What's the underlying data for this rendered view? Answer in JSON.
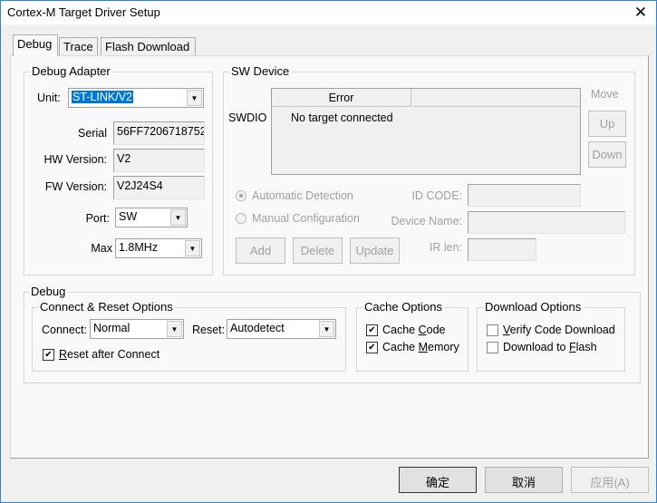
{
  "window": {
    "title": "Cortex-M Target Driver Setup"
  },
  "tabs": [
    {
      "label": "Debug",
      "selected": true
    },
    {
      "label": "Trace"
    },
    {
      "label": "Flash Download"
    }
  ],
  "debug_adapter": {
    "legend": "Debug Adapter",
    "unit_label": "Unit:",
    "unit_value": "ST-LINK/V2",
    "serial_label": "Serial",
    "serial_value": "56FF7206718752",
    "hw_label": "HW Version:",
    "hw_value": "V2",
    "fw_label": "FW Version:",
    "fw_value": "V2J24S4",
    "port_label": "Port:",
    "port_value": "SW",
    "max_label": "Max",
    "max_value": "1.8MHz"
  },
  "sw_device": {
    "legend": "SW Device",
    "row_label": "SWDIO",
    "columns": [
      "Error",
      ""
    ],
    "rows": [
      [
        "No target connected",
        ""
      ]
    ],
    "move_label": "Move",
    "up": "Up",
    "down": "Down",
    "auto_detect": "Automatic Detection",
    "manual_config": "Manual Configuration",
    "selected_mode": "Automatic Detection",
    "id_code_label": "ID CODE:",
    "id_code_value": "",
    "device_name_label": "Device Name:",
    "device_name_value": "",
    "ir_len_label": "IR len:",
    "ir_len_value": "",
    "add": "Add",
    "delete": "Delete",
    "update": "Update"
  },
  "debug": {
    "legend": "Debug",
    "connect_reset": {
      "legend": "Connect & Reset Options",
      "connect_label": "Connect:",
      "connect_value": "Normal",
      "reset_label": "Reset:",
      "reset_value": "Autodetect",
      "reset_after_connect_u": "R",
      "reset_after_connect_rest": "eset after Connect",
      "reset_after_connect": true
    },
    "cache": {
      "legend": "Cache Options",
      "cache_code_a": "Cache ",
      "cache_code_u": "C",
      "cache_code_b": "ode",
      "cache_code": true,
      "cache_memory_a": "Cache ",
      "cache_memory_u": "M",
      "cache_memory_b": "emory",
      "cache_memory": true
    },
    "download": {
      "legend": "Download Options",
      "verify_u": "V",
      "verify_rest": "erify Code Download",
      "verify": false,
      "flash_a": "Download to ",
      "flash_u": "F",
      "flash_b": "lash",
      "flash": false
    }
  },
  "footer": {
    "ok": "确定",
    "cancel": "取消",
    "apply": "应用(A)"
  }
}
